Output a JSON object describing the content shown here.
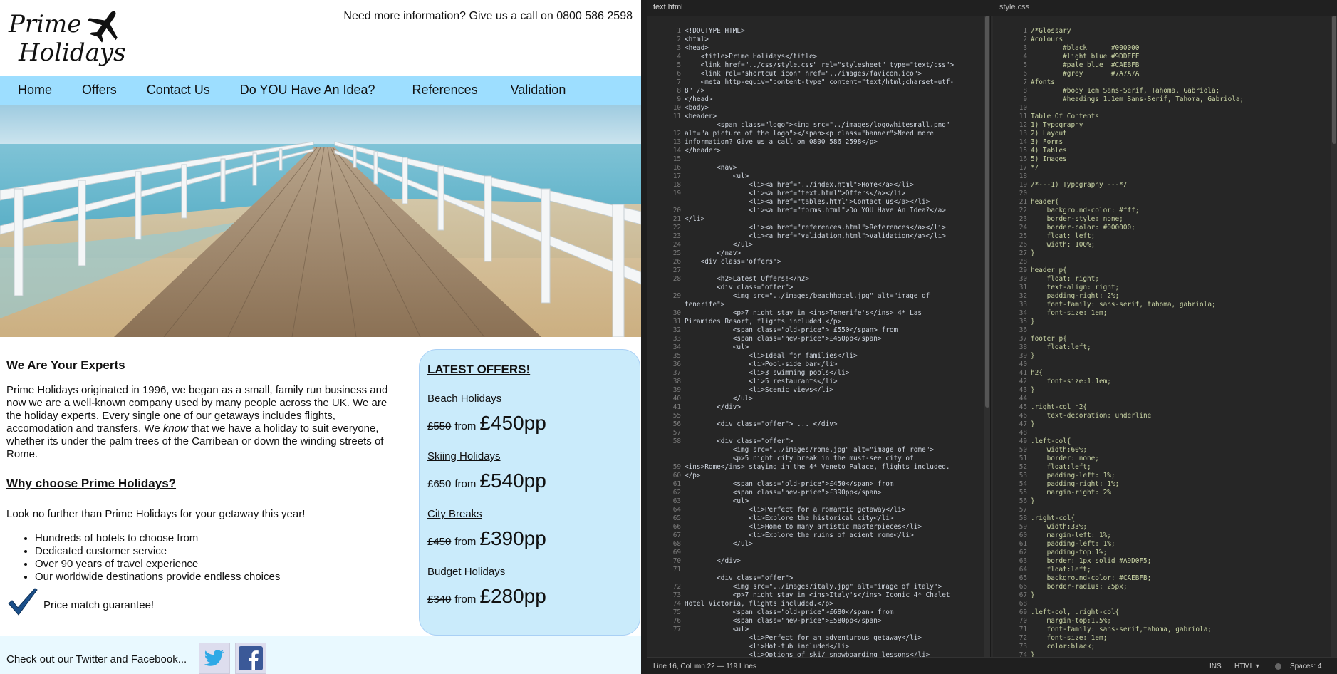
{
  "site": {
    "logo": {
      "line1": "Prime",
      "line2": "Holidays"
    },
    "banner": "Need more information? Give us a call on 0800 586 2598",
    "nav": [
      "Home",
      "Offers",
      "Contact Us",
      "Do YOU Have An Idea?",
      "References",
      "Validation"
    ],
    "experts_heading": "We Are Your Experts",
    "experts_para_before": "Prime Holidays originated in 1996, we began as a small, family run business and now we are a well-known company used by many people across the UK. We are the holiday experts. Every single one of our getaways includes flights, accomodation and transfers. We ",
    "experts_para_em": "know",
    "experts_para_after": " that we have a holiday to suit everyone, whether its under the palm trees of the Carribean or down the winding streets of Rome.",
    "why_heading": "Why choose Prime Holidays?",
    "why_para": "Look no further than Prime Holidays for your getaway this year!",
    "reasons": [
      "Hundreds of hotels to choose from",
      "Dedicated customer service",
      "Over 90 years of travel experience",
      "Our worldwide destinations provide endless choices"
    ],
    "price_match": "Price match guarantee!",
    "offers_title": "LATEST OFFERS!",
    "offers": [
      {
        "name": "Beach Holidays",
        "old": "£550",
        "from": "from",
        "new": "£450pp"
      },
      {
        "name": "Skiing Holidays",
        "old": "£650",
        "from": "from",
        "new": "£540pp"
      },
      {
        "name": "City Breaks",
        "old": "£450",
        "from": "from",
        "new": "£390pp"
      },
      {
        "name": "Budget Holidays",
        "old": "£340",
        "from": "from",
        "new": "£280pp"
      }
    ],
    "footer_text": "Check out our Twitter and Facebook...",
    "colors": {
      "nav_bg": "#9DDEFF",
      "offers_bg": "#CAEBFB",
      "offers_border": "#A9D0F5"
    }
  },
  "editor": {
    "tabs": {
      "html": "text.html",
      "css": "style.css"
    },
    "status": {
      "position": "Line 16, Column 22 — 119 Lines",
      "ins": "INS",
      "lang": "HTML ▾",
      "spaces": "Spaces: 4"
    },
    "html_line_numbers": "1\n2\n3\n4\n5\n6\n7\n8\n9\n10\n11\n\n12\n13\n14\n15\n16\n17\n18\n19\n\n20\n21\n22\n23\n24\n25\n26\n27\n28\n\n29\n\n30\n31\n32\n33\n34\n35\n36\n37\n38\n39\n40\n41\n55\n56\n57\n58\n\n\n59\n60\n61\n62\n63\n64\n65\n66\n67\n68\n69\n70\n71\n\n72\n73\n74\n75\n76\n77",
    "html_code": "<!DOCTYPE HTML>\n<html>\n<head>\n    <title>Prime Holidays</title>\n    <link href=\"../css/style.css\" rel=\"stylesheet\" type=\"text/css\">\n    <link rel=\"shortcut icon\" href=\"../images/favicon.ico\">\n    <meta http-equiv=\"content-type\" content=\"text/html;charset=utf-\n8\" />\n</head>\n<body>\n<header>\n        <span class=\"logo\"><img src=\"../images/logowhitesmall.png\"\nalt=\"a picture of the logo\"></span><p class=\"banner\">Need more\ninformation? Give us a call on 0800 586 2598</p>\n</header>\n\n        <nav>\n            <ul>\n                <li><a href=\"../index.html\">Home</a></li>\n                <li><a href=\"text.html\">Offers</a></li>\n                <li><a href=\"tables.html\">Contact us</a></li>\n                <li><a href=\"forms.html\">Do YOU Have An Idea?</a>\n</li>\n                <li><a href=\"references.html\">References</a></li>\n                <li><a href=\"validation.html\">Validation</a></li>\n            </ul>\n        </nav>\n    <div class=\"offers\">\n\n        <h2>Latest Offers!</h2>\n        <div class=\"offer\">\n            <img src=\"../images/beachhotel.jpg\" alt=\"image of\ntenerife\">\n            <p>7 night stay in <ins>Tenerife's</ins> 4* Las\nPiramides Resort, flights included.</p>\n            <span class=\"old-price\"> £550</span> from\n            <span class=\"new-price\">£450pp</span>\n            <ul>\n                <li>Ideal for families</li>\n                <li>Pool-side bar</li>\n                <li>3 swimming pools</li>\n                <li>5 restaurants</li>\n                <li>Scenic views</li>\n            </ul>\n        </div>\n\n        <div class=\"offer\"> ... </div>\n\n        <div class=\"offer\">\n            <img src=\"../images/rome.jpg\" alt=\"image of rome\">\n            <p>5 night city break in the must-see city of\n<ins>Rome</ins> staying in the 4* Veneto Palace, flights included.\n</p>\n            <span class=\"old-price\">£450</span> from\n            <span class=\"new-price\">£390pp</span>\n            <ul>\n                <li>Perfect for a romantic getaway</li>\n                <li>Explore the historical city</li>\n                <li>Home to many artistic masterpieces</li>\n                <li>Explore the ruins of acient rome</li>\n            </ul>\n\n        </div>\n\n        <div class=\"offer\">\n            <img src=\"../images/italy.jpg\" alt=\"image of italy\">\n            <p>7 night stay in <ins>Italy's</ins> Iconic 4* Chalet\nHotel Victoria, flights included.</p>\n            <span class=\"old-price\">£680</span> from\n            <span class=\"new-price\">£580pp</span>\n            <ul>\n                <li>Perfect for an adventurous getaway</li>\n                <li>Hot-tub included</li>\n                <li>Options of ski/ snowboarding lessons</li>",
    "css_line_numbers": "1\n2\n3\n4\n5\n6\n7\n8\n9\n10\n11\n12\n13\n14\n15\n16\n17\n18\n19\n20\n21\n22\n23\n24\n25\n26\n27\n28\n29\n30\n31\n32\n33\n34\n35\n36\n37\n38\n39\n40\n41\n42\n43\n44\n45\n46\n47\n48\n49\n50\n51\n52\n53\n54\n55\n56\n57\n58\n59\n60\n61\n62\n63\n64\n65\n66\n67\n68\n69\n70\n71\n72\n73\n74",
    "css_code": "/*Glossary\n#colours\n        #black      #000000\n        #light blue #9DDEFF\n        #pale blue  #CAEBFB\n        #grey       #7A7A7A\n#fonts\n        #body 1em Sans-Serif, Tahoma, Gabriola;\n        #headings 1.1em Sans-Serif, Tahoma, Gabriola;\n\nTable Of Contents\n1) Typography\n2) Layout\n3) Forms\n4) Tables\n5) Images\n*/\n\n/*---1) Typography ---*/\n\nheader{\n    background-color: #fff;\n    border-style: none;\n    border-color: #000000;\n    float: left;\n    width: 100%;\n}\n\nheader p{\n    float: right;\n    text-align: right;\n    padding-right: 2%;\n    font-family: sans-serif, tahoma, gabriola;\n    font-size: 1em;\n}\n\nfooter p{\n    float:left;\n}\n\nh2{\n    font-size:1.1em;\n}\n\n.right-col h2{\n    text-decoration: underline\n}\n\n.left-col{\n    width:60%;\n    border: none;\n    float:left;\n    padding-left: 1%;\n    padding-right: 1%;\n    margin-right: 2%\n}\n\n.right-col{\n    width:33%;\n    margin-left: 1%;\n    padding-left: 1%;\n    padding-top:1%;\n    border: 1px solid #A9D0F5;\n    float:left;\n    background-color: #CAEBFB;\n    border-radius: 25px;\n}\n\n.left-col, .right-col{\n    margin-top:1.5%;\n    font-family: sans-serif,tahoma, gabriola;\n    font-size: 1em;\n    color:black;\n}"
  }
}
